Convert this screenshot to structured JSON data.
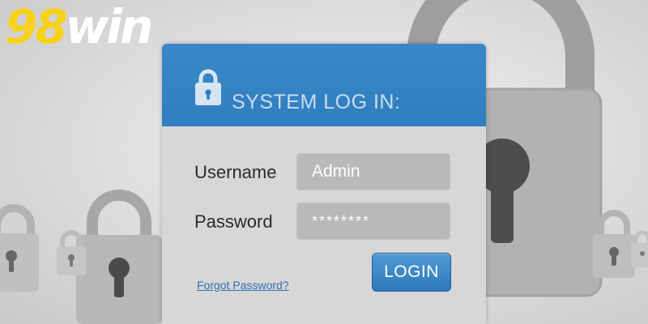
{
  "logo": {
    "number": "98",
    "word": "win"
  },
  "login_panel": {
    "title": "SYSTEM LOG IN:",
    "username_label": "Username",
    "username_value": "Admin",
    "password_label": "Password",
    "password_value": "********",
    "forgot_link": "Forgot Password?",
    "login_button": "LOGIN"
  },
  "colors": {
    "header_blue": "#2f7ebf",
    "logo_yellow": "#f7d21a",
    "button_blue": "#2d78b8",
    "link_blue": "#2c6fb0"
  },
  "icons": {
    "header": "lock-icon",
    "background": "padlock-icon"
  }
}
